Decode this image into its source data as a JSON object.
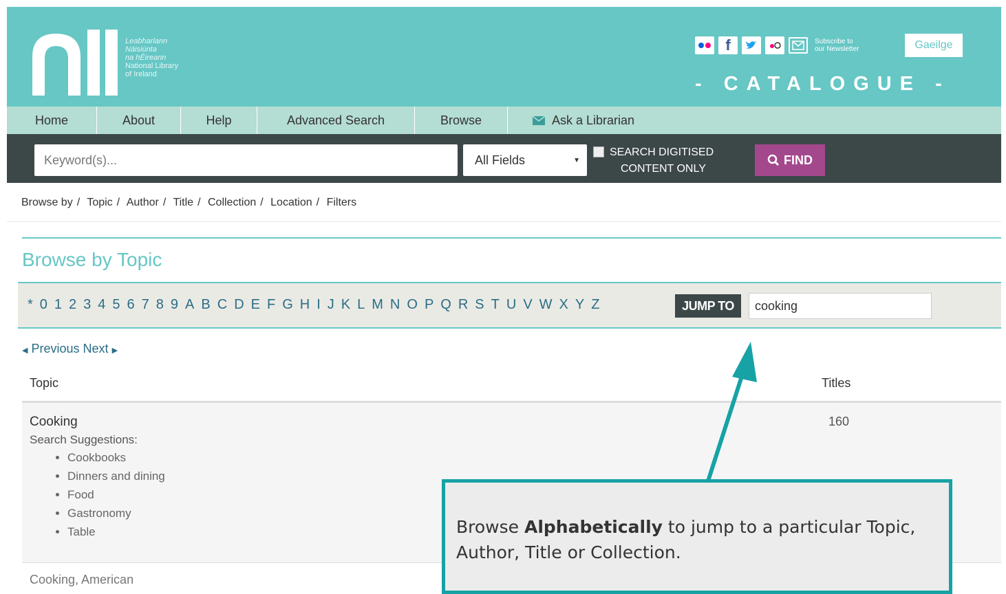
{
  "header": {
    "logo_lines_ga": [
      "Leabharlann",
      "Náisiúnta",
      "na hÉireann"
    ],
    "logo_lines_en": [
      "National Library",
      "of Ireland"
    ],
    "subscribe": [
      "Subscribe to",
      "our Newsletter"
    ],
    "language_button": "Gaeilge",
    "catalogue_label": "- CATALOGUE -",
    "social_icons": [
      "flickr-icon",
      "facebook-icon",
      "twitter-icon",
      "flickr-alt-icon",
      "email-icon"
    ]
  },
  "nav": {
    "items": [
      "Home",
      "About",
      "Help",
      "Advanced Search",
      "Browse"
    ],
    "ask_librarian": "Ask a Librarian"
  },
  "search": {
    "placeholder": "Keyword(s)...",
    "field_select": "All Fields",
    "digitised_label": [
      "SEARCH DIGITISED",
      "CONTENT ONLY"
    ],
    "find_label": "FIND"
  },
  "breadcrumb": [
    "Browse by",
    "Topic",
    "Author",
    "Title",
    "Collection",
    "Location",
    "Filters"
  ],
  "browse": {
    "title": "Browse by Topic",
    "letters": [
      "*",
      "0",
      "1",
      "2",
      "3",
      "4",
      "5",
      "6",
      "7",
      "8",
      "9",
      "A",
      "B",
      "C",
      "D",
      "E",
      "F",
      "G",
      "H",
      "I",
      "J",
      "K",
      "L",
      "M",
      "N",
      "O",
      "P",
      "Q",
      "R",
      "S",
      "T",
      "U",
      "V",
      "W",
      "X",
      "Y",
      "Z"
    ],
    "jump_label": "JUMP TO",
    "jump_value": "cooking",
    "prev": "Previous",
    "next": "Next"
  },
  "table": {
    "col_topic": "Topic",
    "col_titles": "Titles",
    "rows": [
      {
        "name": "Cooking",
        "suggestions_label": "Search Suggestions:",
        "suggestions": [
          "Cookbooks",
          "Dinners and dining",
          "Food",
          "Gastronomy",
          "Table"
        ],
        "count": "160"
      },
      {
        "name": "Cooking, American"
      }
    ]
  },
  "annotation": {
    "text_before": "Browse ",
    "text_bold": "Alphabetically",
    "text_after": " to jump to a particular Topic, Author, Title or Collection.",
    "colors": {
      "border": "#17a2a5",
      "arrow": "#17a2a5"
    }
  },
  "colors": {
    "header_bg": "#66c7c5",
    "nav_bg": "#b4ddd3",
    "search_bg": "#3c4748",
    "find_bg": "#a4488d",
    "link": "#2a6d85"
  }
}
